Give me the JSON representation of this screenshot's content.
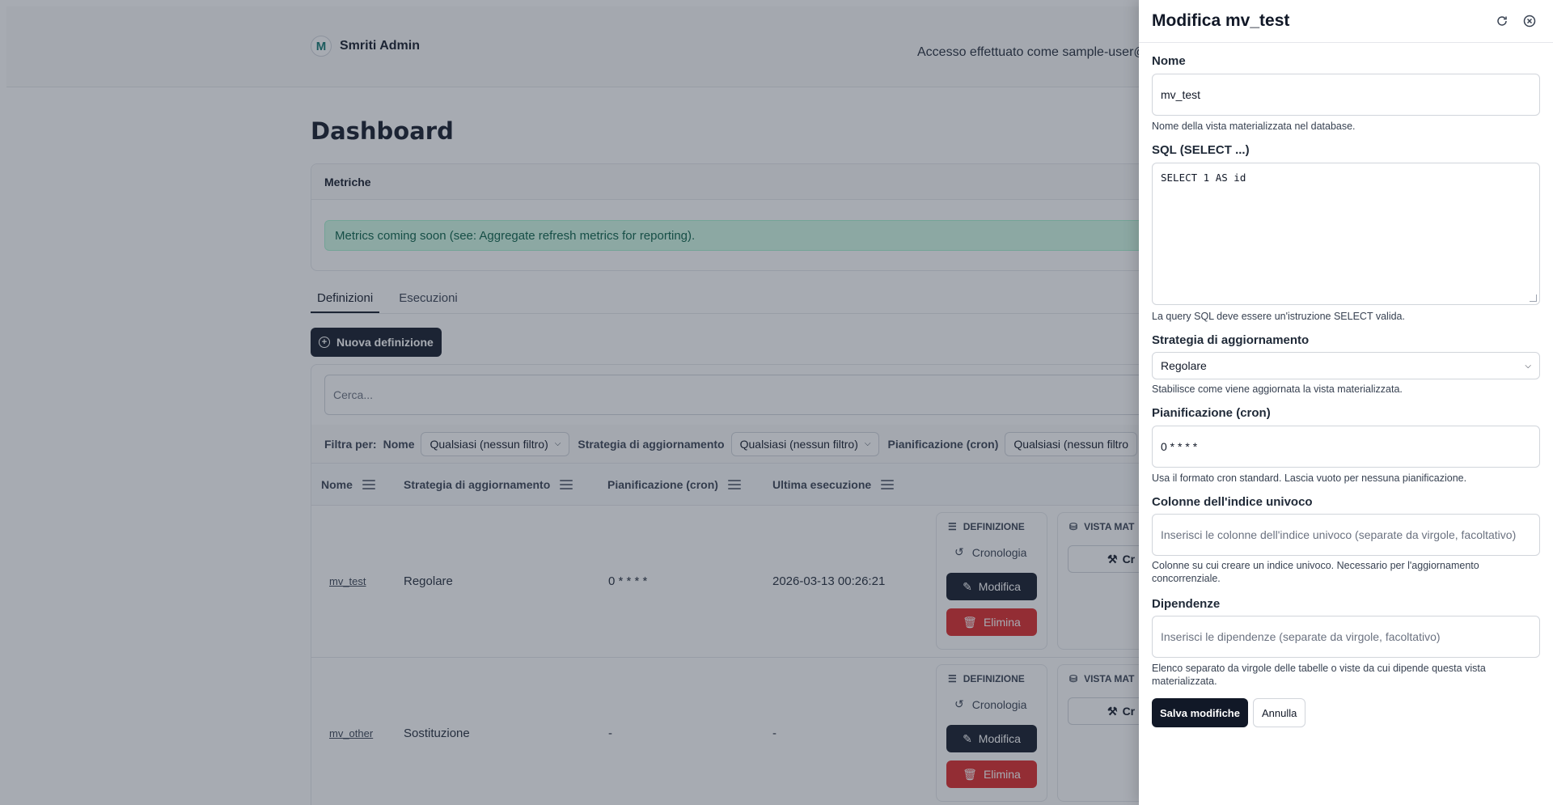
{
  "app": {
    "brand_name": "Smriti Admin",
    "logo_letter": "M",
    "login_text": "Accesso effettuato come sample-user@e",
    "page_title": "Dashboard"
  },
  "metrics": {
    "title": "Metriche",
    "alert": "Metrics coming soon (see: Aggregate refresh metrics for reporting)."
  },
  "tabs": [
    {
      "label": "Definizioni",
      "active": true
    },
    {
      "label": "Esecuzioni",
      "active": false
    }
  ],
  "new_definition_label": "Nuova definizione",
  "search_placeholder": "Cerca...",
  "filters": {
    "label": "Filtra per:",
    "items": [
      {
        "label": "Nome",
        "value": "Qualsiasi (nessun filtro)"
      },
      {
        "label": "Strategia di aggiornamento",
        "value": "Qualsiasi (nessun filtro)"
      },
      {
        "label": "Pianificazione (cron)",
        "value": "Qualsiasi (nessun filtro"
      }
    ]
  },
  "table": {
    "columns": [
      "Nome",
      "Strategia di aggiornamento",
      "Pianificazione (cron)",
      "Ultima esecuzione"
    ],
    "rows": [
      {
        "name": "mv_test",
        "strategy": "Regolare",
        "cron": "0 * * * *",
        "last_run": "2026-03-13 00:26:21"
      },
      {
        "name": "mv_other",
        "strategy": "Sostituzione",
        "cron": "-",
        "last_run": "-"
      }
    ],
    "actions": {
      "definition_header": "DEFINIZIONE",
      "history": "Cronologia",
      "edit": "Modifica",
      "delete": "Elimina",
      "view_header": "VISTA MAT",
      "create": "Cr"
    }
  },
  "drawer": {
    "title": "Modifica mv_test",
    "name_label": "Nome",
    "name_value": "mv_test",
    "name_help": "Nome della vista materializzata nel database.",
    "sql_label": "SQL (SELECT ...)",
    "sql_value": "SELECT 1 AS id",
    "sql_help": "La query SQL deve essere un'istruzione SELECT valida.",
    "strategy_label": "Strategia di aggiornamento",
    "strategy_value": "Regolare",
    "strategy_help": "Stabilisce come viene aggiornata la vista materializzata.",
    "cron_label": "Pianificazione (cron)",
    "cron_value": "0 * * * *",
    "cron_help": "Usa il formato cron standard. Lascia vuoto per nessuna pianificazione.",
    "unique_label": "Colonne dell'indice univoco",
    "unique_placeholder": "Inserisci le colonne dell'indice univoco (separate da virgole, facoltativo)",
    "unique_help": "Colonne su cui creare un indice univoco. Necessario per l'aggiornamento concorrenziale.",
    "deps_label": "Dipendenze",
    "deps_placeholder": "Inserisci le dipendenze (separate da virgole, facoltativo)",
    "deps_help": "Elenco separato da virgole delle tabelle o viste da cui dipende questa vista materializzata.",
    "save_label": "Salva modifiche",
    "cancel_label": "Annulla"
  }
}
